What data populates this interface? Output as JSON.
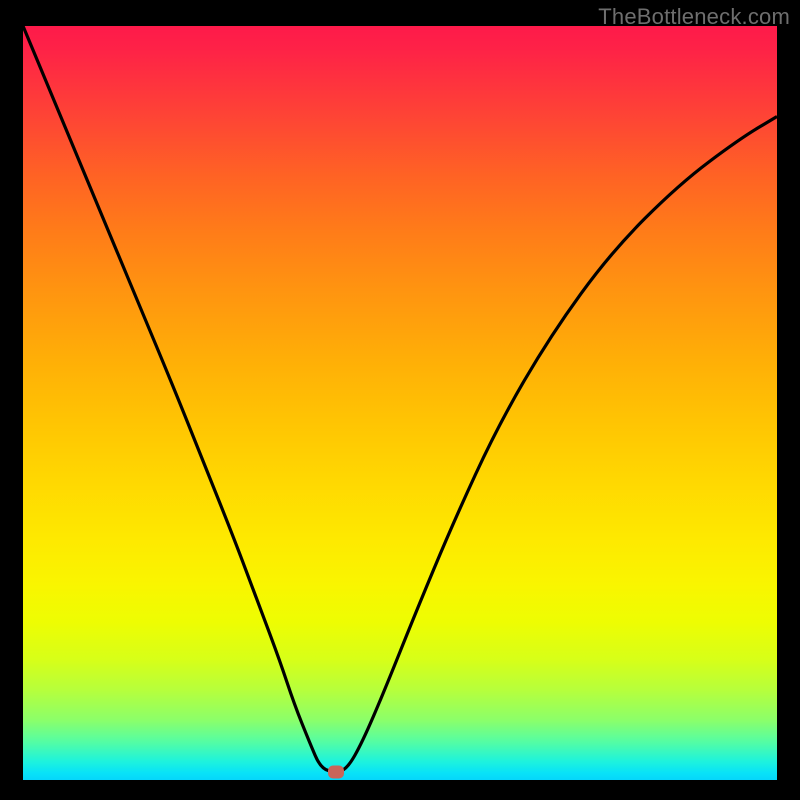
{
  "watermark": "TheBottleneck.com",
  "marker": {
    "x_pct": 41.5,
    "y_pct": 99.0
  },
  "chart_data": {
    "type": "line",
    "title": "",
    "xlabel": "",
    "ylabel": "",
    "xlim": [
      0,
      100
    ],
    "ylim": [
      0,
      100
    ],
    "series": [
      {
        "name": "bottleneck-curve",
        "x": [
          0,
          5,
          10,
          15,
          20,
          24,
          28,
          31,
          34,
          36,
          38,
          39.5,
          41.5,
          43,
          45,
          48,
          52,
          57,
          63,
          70,
          78,
          87,
          95,
          100
        ],
        "y": [
          100,
          88,
          76,
          64,
          52,
          42,
          32,
          24,
          16,
          10,
          5,
          1.5,
          1,
          1.5,
          5,
          12,
          22,
          34,
          47,
          59,
          70,
          79,
          85,
          88
        ]
      }
    ],
    "gradient_colors": {
      "top": "#fe1a4a",
      "mid_high": "#ff9410",
      "mid": "#ffd701",
      "mid_low": "#eefd02",
      "low": "#1ef3dc",
      "bottom": "#05d6fb"
    },
    "marker": {
      "x": 41.5,
      "y": 1,
      "color": "#c9655a"
    }
  }
}
